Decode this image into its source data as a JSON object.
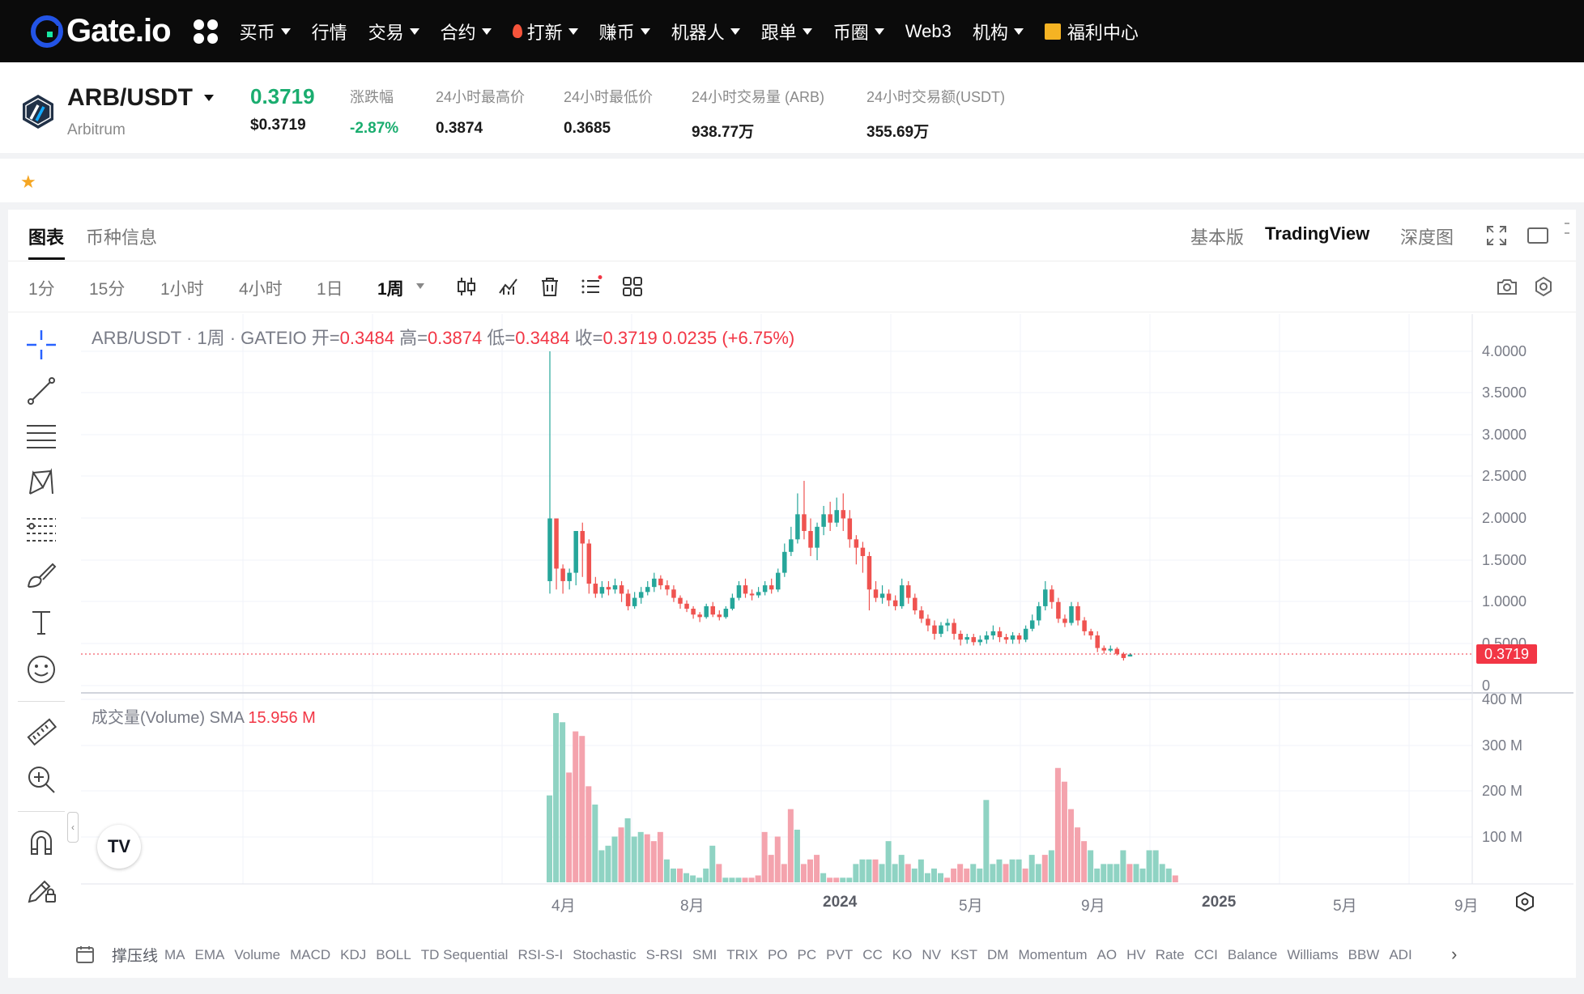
{
  "nav": {
    "logo_text": "Gate.io",
    "items": [
      {
        "label": "买币",
        "dropdown": true
      },
      {
        "label": "行情",
        "dropdown": false
      },
      {
        "label": "交易",
        "dropdown": true
      },
      {
        "label": "合约",
        "dropdown": true
      },
      {
        "label": "打新",
        "dropdown": true,
        "icon": "fire-icon"
      },
      {
        "label": "赚币",
        "dropdown": true
      },
      {
        "label": "机器人",
        "dropdown": true
      },
      {
        "label": "跟单",
        "dropdown": true
      },
      {
        "label": "币圈",
        "dropdown": true
      },
      {
        "label": "Web3",
        "dropdown": false
      },
      {
        "label": "机构",
        "dropdown": true
      },
      {
        "label": "福利中心",
        "dropdown": false,
        "icon": "gift-icon"
      }
    ]
  },
  "ticker": {
    "pair": "ARB/USDT",
    "coin_name": "Arbitrum",
    "price": "0.3719",
    "price_usd": "$0.3719",
    "change_label": "涨跌幅",
    "change_value": "-2.87%",
    "high_label": "24小时最高价",
    "high_value": "0.3874",
    "low_label": "24小时最低价",
    "low_value": "0.3685",
    "vol_label": "24小时交易量 (ARB)",
    "vol_value": "938.77万",
    "amount_label": "24小时交易额(USDT)",
    "amount_value": "355.69万"
  },
  "tabs": {
    "chart": "图表",
    "coin_info": "币种信息",
    "basic": "基本版",
    "tradingview": "TradingView",
    "depth": "深度图"
  },
  "intervals": [
    "1分",
    "15分",
    "1小时",
    "4小时",
    "1日",
    "1周"
  ],
  "legend": {
    "title": "ARB/USDT · 1周 · GATEIO",
    "open_label": "开=",
    "open": "0.3484",
    "high_label": "高=",
    "high": "0.3874",
    "low_label": "低=",
    "low": "0.3484",
    "close_label": "收=",
    "close": "0.3719",
    "change": "0.0235 (+6.75%)"
  },
  "volume_legend": {
    "label": "成交量(Volume) SMA",
    "value": "15.956 M"
  },
  "current_price_tag": "0.3719",
  "price_axis": [
    "4.0000",
    "3.5000",
    "3.0000",
    "2.5000",
    "2.0000",
    "1.5000",
    "1.0000",
    "0.5000",
    "0"
  ],
  "volume_axis": [
    "400 M",
    "300 M",
    "200 M",
    "100 M"
  ],
  "time_axis": [
    {
      "label": "4月",
      "bold": false
    },
    {
      "label": "8月",
      "bold": false
    },
    {
      "label": "2024",
      "bold": true
    },
    {
      "label": "5月",
      "bold": false
    },
    {
      "label": "9月",
      "bold": false
    },
    {
      "label": "2025",
      "bold": true
    },
    {
      "label": "5月",
      "bold": false
    },
    {
      "label": "9月",
      "bold": false
    }
  ],
  "indicators": {
    "first": "撑压线",
    "list": [
      "MA",
      "EMA",
      "Volume",
      "MACD",
      "KDJ",
      "BOLL",
      "TD Sequential",
      "RSI-S-I",
      "Stochastic",
      "S-RSI",
      "SMI",
      "TRIX",
      "PO",
      "PC",
      "PVT",
      "CC",
      "KO",
      "NV",
      "KST",
      "DM",
      "Momentum",
      "AO",
      "HV",
      "Rate",
      "CCI",
      "Balance",
      "Williams",
      "BBW",
      "ADI"
    ]
  },
  "colors": {
    "up": "#26a69a",
    "down": "#ef5350",
    "price_green": "#1aad6f",
    "change_green": "#1aad6f",
    "accent_blue": "#2962ff"
  },
  "chart_data": {
    "type": "candlestick",
    "pair": "ARB/USDT",
    "interval": "1周",
    "ylim": [
      0,
      4.0
    ],
    "candles": [
      [
        1.25,
        2.0,
        4.0,
        1.1
      ],
      [
        2.0,
        1.4,
        1.95,
        1.15
      ],
      [
        1.4,
        1.25,
        1.45,
        1.1
      ],
      [
        1.25,
        1.35,
        1.4,
        1.15
      ],
      [
        1.35,
        1.85,
        1.85,
        1.2
      ],
      [
        1.85,
        1.7,
        1.95,
        1.3
      ],
      [
        1.7,
        1.22,
        1.75,
        1.1
      ],
      [
        1.22,
        1.1,
        1.3,
        1.05
      ],
      [
        1.1,
        1.18,
        1.25,
        1.05
      ],
      [
        1.18,
        1.15,
        1.25,
        1.08
      ],
      [
        1.15,
        1.2,
        1.28,
        1.1
      ],
      [
        1.2,
        1.1,
        1.25,
        1.0
      ],
      [
        1.1,
        0.95,
        1.15,
        0.9
      ],
      [
        0.95,
        1.05,
        1.12,
        0.92
      ],
      [
        1.05,
        1.12,
        1.18,
        0.98
      ],
      [
        1.12,
        1.18,
        1.25,
        1.08
      ],
      [
        1.18,
        1.28,
        1.35,
        1.12
      ],
      [
        1.28,
        1.2,
        1.32,
        1.15
      ],
      [
        1.2,
        1.15,
        1.26,
        1.08
      ],
      [
        1.15,
        1.05,
        1.2,
        1.0
      ],
      [
        1.05,
        0.98,
        1.08,
        0.92
      ],
      [
        0.98,
        0.92,
        1.02,
        0.88
      ],
      [
        0.92,
        0.85,
        0.95,
        0.8
      ],
      [
        0.85,
        0.82,
        0.88,
        0.76
      ],
      [
        0.82,
        0.95,
        0.98,
        0.8
      ],
      [
        0.95,
        0.85,
        1.0,
        0.82
      ],
      [
        0.85,
        0.82,
        0.9,
        0.78
      ],
      [
        0.82,
        0.92,
        0.95,
        0.8
      ],
      [
        0.92,
        1.05,
        1.1,
        0.9
      ],
      [
        1.05,
        1.2,
        1.25,
        1.02
      ],
      [
        1.2,
        1.1,
        1.28,
        1.05
      ],
      [
        1.1,
        1.08,
        1.15,
        1.02
      ],
      [
        1.08,
        1.12,
        1.18,
        1.05
      ],
      [
        1.12,
        1.2,
        1.25,
        1.08
      ],
      [
        1.2,
        1.15,
        1.28,
        1.1
      ],
      [
        1.15,
        1.35,
        1.4,
        1.12
      ],
      [
        1.35,
        1.6,
        1.7,
        1.3
      ],
      [
        1.6,
        1.75,
        1.9,
        1.55
      ],
      [
        1.75,
        2.05,
        2.3,
        1.7
      ],
      [
        2.05,
        1.85,
        2.45,
        1.75
      ],
      [
        1.85,
        1.65,
        2.0,
        1.55
      ],
      [
        1.65,
        1.9,
        1.95,
        1.5
      ],
      [
        1.9,
        2.05,
        2.15,
        1.8
      ],
      [
        2.05,
        1.95,
        2.2,
        1.85
      ],
      [
        1.95,
        2.1,
        2.25,
        1.9
      ],
      [
        2.1,
        2.0,
        2.3,
        1.85
      ],
      [
        2.0,
        1.75,
        2.1,
        1.65
      ],
      [
        1.75,
        1.65,
        1.8,
        1.45
      ],
      [
        1.65,
        1.55,
        1.72,
        1.35
      ],
      [
        1.55,
        1.15,
        1.6,
        0.9
      ],
      [
        1.15,
        1.05,
        1.25,
        1.0
      ],
      [
        1.05,
        1.1,
        1.2,
        0.98
      ],
      [
        1.1,
        1.02,
        1.15,
        0.95
      ],
      [
        1.02,
        0.95,
        1.08,
        0.9
      ],
      [
        0.95,
        1.2,
        1.28,
        0.92
      ],
      [
        1.2,
        1.05,
        1.25,
        0.98
      ],
      [
        1.05,
        0.9,
        1.1,
        0.85
      ],
      [
        0.9,
        0.8,
        0.95,
        0.75
      ],
      [
        0.8,
        0.72,
        0.85,
        0.65
      ],
      [
        0.72,
        0.62,
        0.78,
        0.55
      ],
      [
        0.62,
        0.72,
        0.76,
        0.58
      ],
      [
        0.72,
        0.75,
        0.8,
        0.65
      ],
      [
        0.75,
        0.62,
        0.8,
        0.55
      ],
      [
        0.62,
        0.55,
        0.66,
        0.48
      ],
      [
        0.55,
        0.58,
        0.62,
        0.5
      ],
      [
        0.58,
        0.52,
        0.62,
        0.48
      ],
      [
        0.52,
        0.55,
        0.6,
        0.48
      ],
      [
        0.55,
        0.6,
        0.65,
        0.5
      ],
      [
        0.6,
        0.65,
        0.72,
        0.55
      ],
      [
        0.65,
        0.58,
        0.7,
        0.52
      ],
      [
        0.58,
        0.55,
        0.62,
        0.5
      ],
      [
        0.55,
        0.6,
        0.64,
        0.5
      ],
      [
        0.6,
        0.55,
        0.63,
        0.5
      ],
      [
        0.55,
        0.68,
        0.72,
        0.52
      ],
      [
        0.68,
        0.78,
        0.85,
        0.65
      ],
      [
        0.78,
        0.95,
        1.0,
        0.72
      ],
      [
        0.95,
        1.15,
        1.25,
        0.9
      ],
      [
        1.15,
        1.0,
        1.2,
        0.92
      ],
      [
        1.0,
        0.8,
        1.05,
        0.75
      ],
      [
        0.8,
        0.75,
        0.85,
        0.7
      ],
      [
        0.75,
        0.95,
        1.0,
        0.72
      ],
      [
        0.95,
        0.78,
        1.0,
        0.72
      ],
      [
        0.78,
        0.65,
        0.82,
        0.6
      ],
      [
        0.65,
        0.6,
        0.68,
        0.55
      ],
      [
        0.6,
        0.45,
        0.65,
        0.4
      ],
      [
        0.45,
        0.42,
        0.48,
        0.38
      ],
      [
        0.42,
        0.44,
        0.48,
        0.4
      ],
      [
        0.44,
        0.38,
        0.46,
        0.36
      ],
      [
        0.38,
        0.33,
        0.4,
        0.3
      ],
      [
        0.3484,
        0.3719,
        0.3874,
        0.3484
      ]
    ],
    "volume": [
      [
        190,
        1
      ],
      [
        370,
        1
      ],
      [
        350,
        1
      ],
      [
        240,
        0
      ],
      [
        330,
        0
      ],
      [
        320,
        0
      ],
      [
        210,
        0
      ],
      [
        170,
        1
      ],
      [
        70,
        1
      ],
      [
        80,
        1
      ],
      [
        100,
        1
      ],
      [
        120,
        0
      ],
      [
        140,
        1
      ],
      [
        100,
        1
      ],
      [
        110,
        1
      ],
      [
        105,
        0
      ],
      [
        90,
        0
      ],
      [
        110,
        0
      ],
      [
        50,
        1
      ],
      [
        30,
        1
      ],
      [
        30,
        0
      ],
      [
        20,
        1
      ],
      [
        15,
        1
      ],
      [
        10,
        1
      ],
      [
        30,
        1
      ],
      [
        80,
        1
      ],
      [
        40,
        0
      ],
      [
        10,
        1
      ],
      [
        10,
        1
      ],
      [
        10,
        1
      ],
      [
        10,
        0
      ],
      [
        10,
        0
      ],
      [
        15,
        0
      ],
      [
        110,
        0
      ],
      [
        60,
        0
      ],
      [
        100,
        0
      ],
      [
        40,
        0
      ],
      [
        160,
        0
      ],
      [
        115,
        1
      ],
      [
        40,
        0
      ],
      [
        50,
        0
      ],
      [
        60,
        0
      ],
      [
        20,
        1
      ],
      [
        10,
        0
      ],
      [
        10,
        0
      ],
      [
        10,
        1
      ],
      [
        10,
        1
      ],
      [
        40,
        1
      ],
      [
        50,
        1
      ],
      [
        50,
        1
      ],
      [
        50,
        0
      ],
      [
        40,
        1
      ],
      [
        90,
        1
      ],
      [
        40,
        1
      ],
      [
        60,
        1
      ],
      [
        40,
        0
      ],
      [
        30,
        1
      ],
      [
        50,
        1
      ],
      [
        20,
        1
      ],
      [
        30,
        1
      ],
      [
        20,
        1
      ],
      [
        10,
        0
      ],
      [
        30,
        0
      ],
      [
        40,
        0
      ],
      [
        30,
        0
      ],
      [
        40,
        1
      ],
      [
        30,
        1
      ],
      [
        180,
        1
      ],
      [
        40,
        1
      ],
      [
        50,
        1
      ],
      [
        40,
        0
      ],
      [
        50,
        1
      ],
      [
        50,
        1
      ],
      [
        30,
        0
      ],
      [
        60,
        1
      ],
      [
        40,
        1
      ],
      [
        60,
        0
      ],
      [
        70,
        1
      ],
      [
        250,
        0
      ],
      [
        220,
        0
      ],
      [
        160,
        0
      ],
      [
        120,
        0
      ],
      [
        90,
        0
      ],
      [
        70,
        1
      ],
      [
        30,
        1
      ],
      [
        40,
        1
      ],
      [
        40,
        1
      ],
      [
        40,
        1
      ],
      [
        70,
        1
      ],
      [
        40,
        0
      ],
      [
        40,
        1
      ],
      [
        30,
        1
      ],
      [
        70,
        1
      ],
      [
        70,
        1
      ],
      [
        40,
        1
      ],
      [
        30,
        1
      ],
      [
        15,
        0
      ]
    ]
  }
}
